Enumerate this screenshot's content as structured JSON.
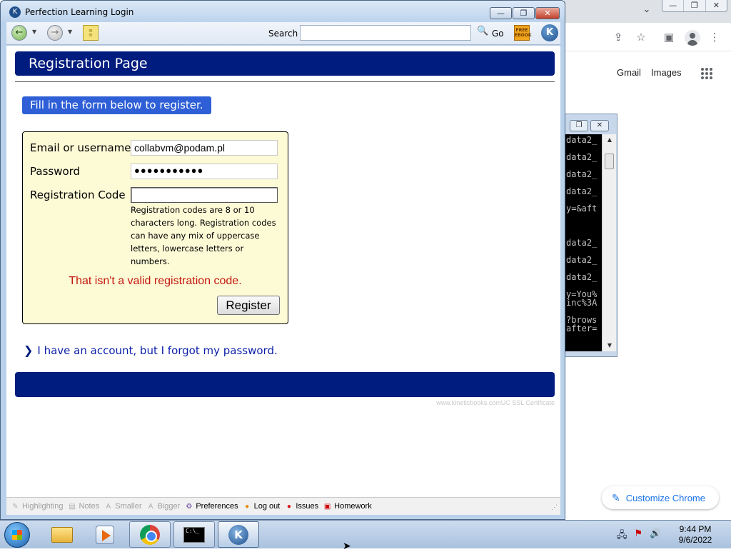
{
  "chrome": {
    "tab_chevron": "⌄",
    "win_buttons": [
      "—",
      "❐",
      "✕"
    ],
    "toolbar_icons": [
      "share-icon",
      "star-icon",
      "sidebar-icon",
      "profile-icon",
      "more-icon"
    ],
    "share_glyph": "⇪",
    "star_glyph": "☆",
    "sidebar_glyph": "▣",
    "more_glyph": "⋮",
    "gmail_link": "Gmail",
    "images_link": "Images",
    "customize_label": "Customize Chrome"
  },
  "console": {
    "lines": [
      "data2_",
      "data2_",
      "data2_",
      "data2_",
      "y=&aft",
      "",
      "data2_",
      "data2_",
      "data2_",
      "y=You%",
      "inc%3A",
      "?brows",
      "after="
    ]
  },
  "window": {
    "title": "Perfection Learning Login",
    "app_icon_glyph": "K",
    "min_glyph": "—",
    "max_glyph": "❐",
    "close_glyph": "✕",
    "toolbar": {
      "back_glyph": "←",
      "forward_glyph": "→",
      "dropdown_glyph": "▼",
      "search_label": "Search",
      "search_value": "",
      "go_label": "Go",
      "ebook_label": "FREE EBOOK",
      "logo_glyph": "K"
    }
  },
  "page": {
    "header_title": "Registration Page",
    "intro": "Fill in the form below to register.",
    "form": {
      "email_label": "Email or username",
      "email_value": "collabvm@podam.pl",
      "password_label": "Password",
      "password_value": "●●●●●●●●●●●",
      "code_label": "Registration Code",
      "code_value": "",
      "hint": "Registration codes are 8 or 10 characters long. Registration codes can have any mix of uppercase letters, lowercase letters or numbers.",
      "error": "That isn't a valid registration code.",
      "register_label": "Register"
    },
    "forgot_link": "I have an account, but I forgot my password.",
    "footer_credit": "www.kineticbooks.comUC SSL Certificate"
  },
  "statusbar": {
    "items": [
      {
        "label": "Highlighting",
        "enabled": false,
        "icon": "highlight-icon"
      },
      {
        "label": "Notes",
        "enabled": false,
        "icon": "notes-icon"
      },
      {
        "label": "Smaller",
        "enabled": false,
        "icon": "smaller-icon"
      },
      {
        "label": "Bigger",
        "enabled": false,
        "icon": "bigger-icon"
      },
      {
        "label": "Preferences",
        "enabled": true,
        "icon": "preferences-icon"
      },
      {
        "label": "Log out",
        "enabled": true,
        "icon": "logout-icon"
      },
      {
        "label": "Issues",
        "enabled": true,
        "icon": "issues-icon"
      },
      {
        "label": "Homework",
        "enabled": true,
        "icon": "homework-icon"
      }
    ]
  },
  "taskbar": {
    "cmd_text": "C:\\_",
    "kb_glyph": "K",
    "tray_icons": [
      "network-icon",
      "flag-icon",
      "volume-icon"
    ],
    "time": "9:44 PM",
    "date": "9/6/2022"
  }
}
